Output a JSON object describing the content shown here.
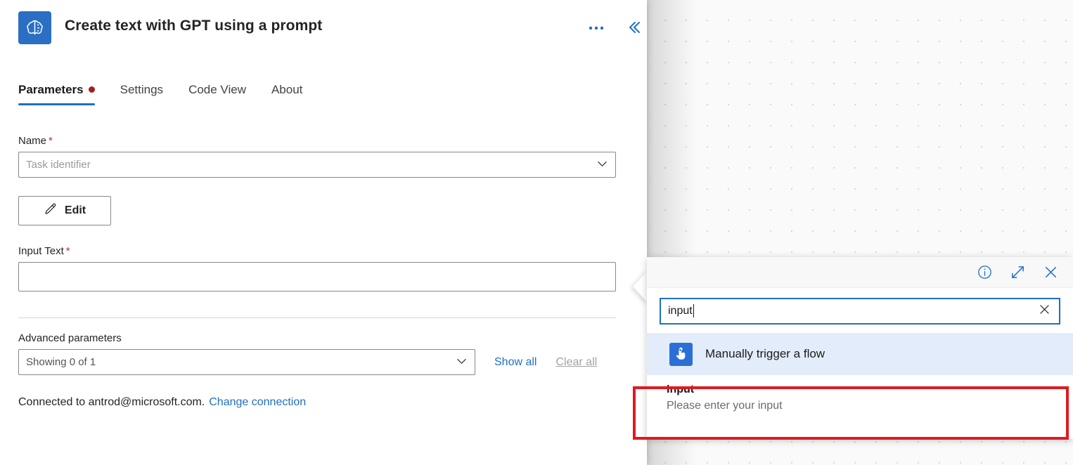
{
  "header": {
    "title": "Create text with GPT using a prompt",
    "app_icon": "ai-brain-icon",
    "more_label": "•••",
    "collapse_label": "«",
    "brand_color": "#2b6fc4",
    "accent_color": "#1f6fc4"
  },
  "tabs": [
    {
      "label": "Parameters",
      "active": true,
      "has_dot": true,
      "dot_color": "#a42020"
    },
    {
      "label": "Settings",
      "active": false,
      "has_dot": false
    },
    {
      "label": "Code View",
      "active": false,
      "has_dot": false
    },
    {
      "label": "About",
      "active": false,
      "has_dot": false
    }
  ],
  "form": {
    "name": {
      "label": "Name",
      "required_marker": "*",
      "placeholder": "Task identifier",
      "value": "Task identifier"
    },
    "edit_button": {
      "label": "Edit",
      "icon": "pencil-icon"
    },
    "input_text": {
      "label": "Input Text",
      "required_marker": "*",
      "value": "",
      "placeholder": ""
    },
    "advanced": {
      "label": "Advanced parameters",
      "value": "Showing 0 of 1",
      "show_all_label": "Show all",
      "clear_all_label": "Clear all"
    },
    "connection": {
      "text": "Connected to antrod@microsoft.com.",
      "change_label": "Change connection"
    }
  },
  "dynamic_content": {
    "toolbar": {
      "info_label": "i",
      "expand_label": "expand-icon",
      "close_label": "close-icon"
    },
    "search": {
      "value": "input",
      "placeholder": "",
      "clear_label": "clear-icon"
    },
    "groups": [
      {
        "label": "Manually trigger a flow",
        "icon": "tap-hand-icon",
        "items": [
          {
            "title": "Input",
            "description": "Please enter your input",
            "highlighted": true
          }
        ]
      }
    ]
  },
  "annotation": {
    "highlight_color": "#e01a20"
  }
}
